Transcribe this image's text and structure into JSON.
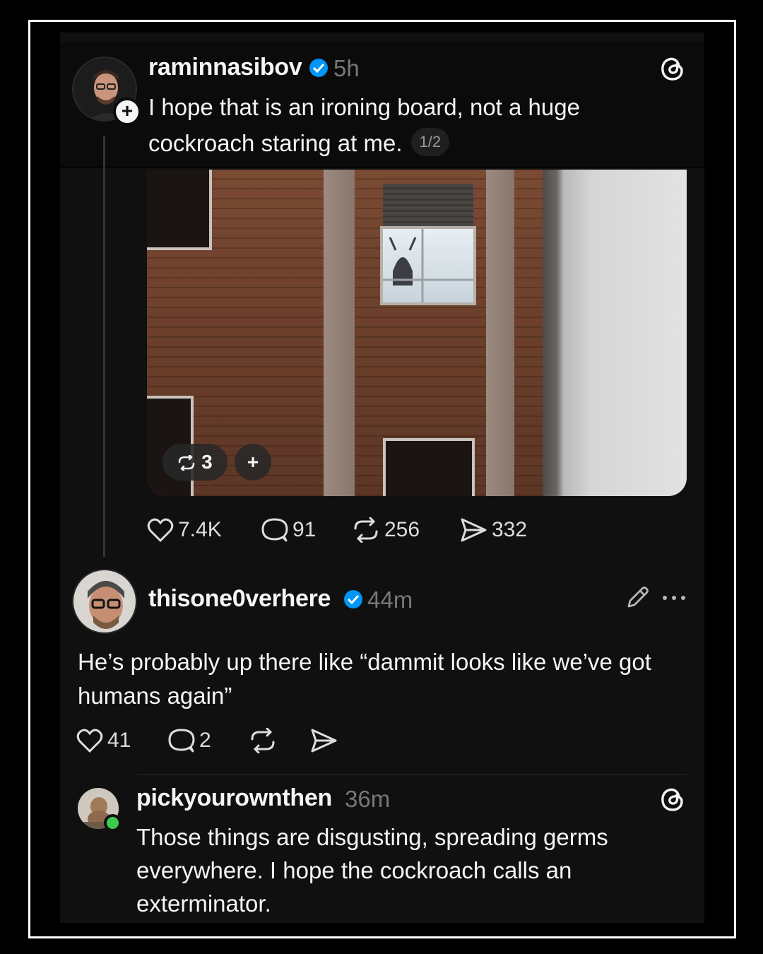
{
  "post": {
    "username": "raminnasibov",
    "time": "5h",
    "text": "I hope that is an ironing board, not a huge cockroach staring at me.",
    "pager": "1/2",
    "media": {
      "repost_count": "3",
      "add_label": "+"
    },
    "stats": {
      "likes": "7.4K",
      "replies": "91",
      "reposts": "256",
      "shares": "332"
    }
  },
  "reply": {
    "username": "thisone0verhere",
    "time": "44m",
    "text": "He’s probably up there like “dammit looks like we’ve got humans again”",
    "stats": {
      "likes": "41",
      "replies": "2"
    }
  },
  "sub_reply": {
    "username": "pickyourownthen",
    "time": "36m",
    "text": "Those things are disgusting, spreading germs everywhere. I hope the cockroach calls an exterminator."
  },
  "icons": [
    "threads-logo-icon",
    "verified-badge-icon",
    "follow-plus-icon",
    "heart-icon",
    "comment-icon",
    "repost-icon",
    "share-icon",
    "edit-pencil-icon",
    "more-options-icon"
  ],
  "colors": {
    "background": "#101010",
    "verified": "#0095f6",
    "online": "#3ccb4f"
  }
}
